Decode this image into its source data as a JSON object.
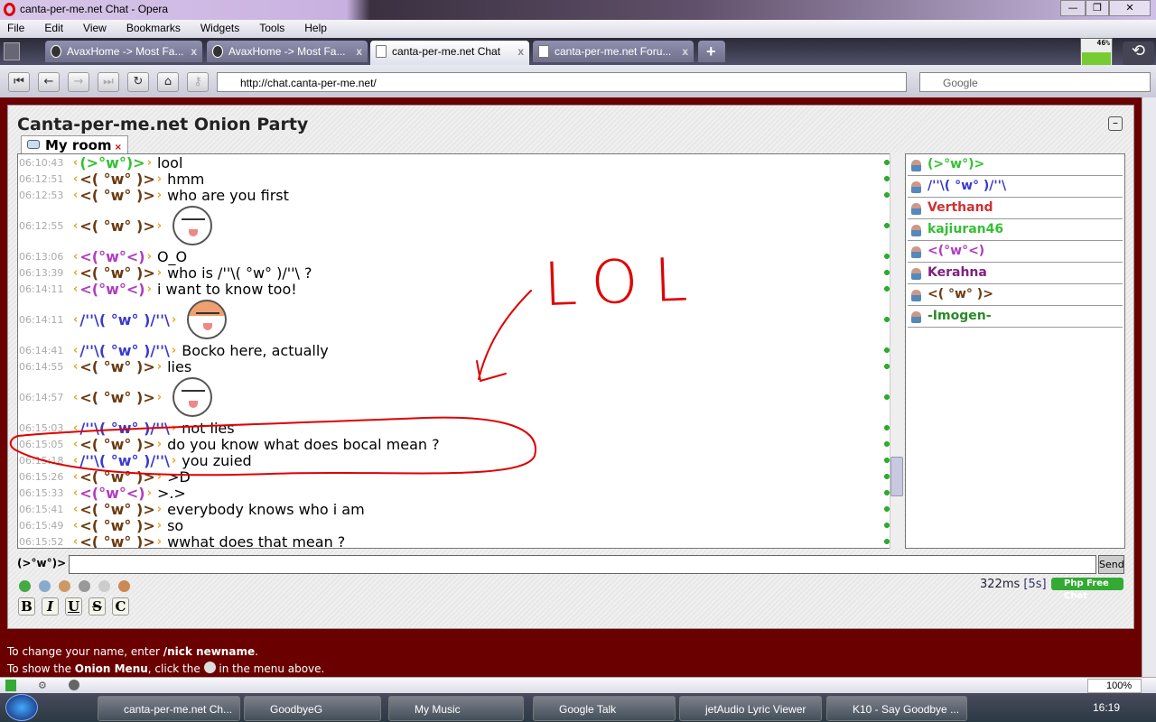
{
  "window": {
    "title": "canta-per-me.net Chat - Opera",
    "minimize": "—",
    "restore": "❐",
    "close": "✕"
  },
  "menu": [
    "File",
    "Edit",
    "View",
    "Bookmarks",
    "Widgets",
    "Tools",
    "Help"
  ],
  "tabs": [
    {
      "label": "AvaxHome -> Most Fa...",
      "close": "x"
    },
    {
      "label": "AvaxHome -> Most Fa...",
      "close": "x"
    },
    {
      "label": "canta-per-me.net Chat",
      "close": "x"
    },
    {
      "label": "canta-per-me.net Foru...",
      "close": "x"
    }
  ],
  "new_tab": "+",
  "cpu_meter": "46%",
  "address": {
    "url": "http://chat.canta-per-me.net/",
    "search_placeholder": "Google"
  },
  "nav": {
    "first": "⏮",
    "back": "←",
    "forward": "→",
    "last": "⏭",
    "reload": "↻",
    "home": "⌂",
    "wand": "⚷"
  },
  "chat": {
    "title": "Canta-per-me.net Onion Party",
    "collapse": "–",
    "room_tab": "My room",
    "room_close": "×",
    "nick_colors": {
      "green": "#33c033",
      "brown": "#6b3a10",
      "purple": "#b03cc0",
      "blue": "#3a3acc"
    },
    "messages": [
      {
        "time": "06:10:43",
        "nick": "(>°w°)>",
        "color": "green",
        "text": "lool"
      },
      {
        "time": "06:12:51",
        "nick": "<( °w° )>",
        "color": "brown",
        "text": "hmm"
      },
      {
        "time": "06:12:53",
        "nick": "<( °w° )>",
        "color": "brown",
        "text": "who are you first"
      },
      {
        "time": "06:12:55",
        "nick": "<( °w° )>",
        "color": "brown",
        "smiley": "onion-smirk"
      },
      {
        "time": "06:13:06",
        "nick": "<(°w°<)",
        "color": "purple",
        "text": "O_O"
      },
      {
        "time": "06:13:39",
        "nick": "<( °w° )>",
        "color": "brown",
        "text": "who is /''\\( °w° )/''\\ ?"
      },
      {
        "time": "06:14:11",
        "nick": "<(°w°<)",
        "color": "purple",
        "text": "i want to know too!"
      },
      {
        "time": "06:14:11",
        "nick": "/''\\( °w° )/''\\",
        "color": "blue",
        "smiley": "onion-hide"
      },
      {
        "time": "06:14:41",
        "nick": "/''\\( °w° )/''\\",
        "color": "blue",
        "text": "Bocko here, actually"
      },
      {
        "time": "06:14:55",
        "nick": "<( °w° )>",
        "color": "brown",
        "text": "lies"
      },
      {
        "time": "06:14:57",
        "nick": "<( °w° )>",
        "color": "brown",
        "smiley": "onion-shocked"
      },
      {
        "time": "06:15:03",
        "nick": "/''\\( °w° )/''\\",
        "color": "blue",
        "text": "not lies"
      },
      {
        "time": "06:15:05",
        "nick": "<( °w° )>",
        "color": "brown",
        "text": "do you know what does bocal mean ?"
      },
      {
        "time": "06:15:18",
        "nick": "/''\\( °w° )/''\\",
        "color": "blue",
        "text": "you zuied"
      },
      {
        "time": "06:15:26",
        "nick": "<( °w° )>",
        "color": "brown",
        "text": ">D"
      },
      {
        "time": "06:15:33",
        "nick": "<(°w°<)",
        "color": "purple",
        "text": ">.>"
      },
      {
        "time": "06:15:41",
        "nick": "<( °w° )>",
        "color": "brown",
        "text": "everybody knows who i am"
      },
      {
        "time": "06:15:49",
        "nick": "<( °w° )>",
        "color": "brown",
        "text": "so"
      },
      {
        "time": "06:15:52",
        "nick": "<( °w° )>",
        "color": "brown",
        "text": "wwhat does that mean ?"
      }
    ],
    "users": [
      {
        "name": "(>°w°)>",
        "color": "#33c033"
      },
      {
        "name": "/''\\( °w° )/''\\",
        "color": "#3a3acc"
      },
      {
        "name": "Verthand",
        "color": "#d03030"
      },
      {
        "name": "kajiuran46",
        "color": "#33c033"
      },
      {
        "name": "<(°w°<)",
        "color": "#b03cc0"
      },
      {
        "name": "Kerahna",
        "color": "#802080"
      },
      {
        "name": "<( °w° )>",
        "color": "#6b3a10"
      },
      {
        "name": "-Imogen-",
        "color": "#2a8a2a"
      }
    ],
    "current_nick": "(>°w°)>",
    "input_value": "",
    "send_label": "Send",
    "format_buttons": [
      "B",
      "I",
      "U",
      "S",
      "C"
    ],
    "tool_icons": [
      "smiley-menu-icon",
      "colors-icon",
      "clock-icon",
      "sound-icon",
      "smiley-icon",
      "users-icon"
    ],
    "ping": "322ms",
    "refresh": "[5s]",
    "powered_by": "Php Free Chat"
  },
  "footer": {
    "line1_pre": "To change your name, enter ",
    "line1_cmd": "/nick newname",
    "line1_post": ".",
    "line2_pre": "To show the ",
    "line2_bold": "Onion Menu",
    "line2_mid": ", click the ",
    "line2_post": " in the menu above."
  },
  "annotation": {
    "text": "LOL",
    "color": "#e00000"
  },
  "statusbar": {
    "zoom": "100%"
  },
  "taskbar": {
    "items": [
      "canta-per-me.net Ch...",
      "GoodbyeG",
      "My Music",
      "Google Talk",
      "jetAudio Lyric Viewer",
      "K10 - Say Goodbye ..."
    ],
    "clock": "16:19"
  }
}
